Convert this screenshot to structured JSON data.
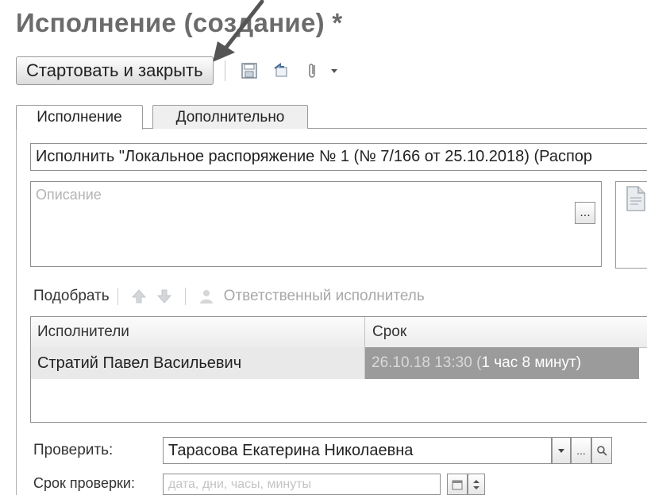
{
  "window": {
    "title": "Исполнение (создание) *"
  },
  "toolbar": {
    "start_close_label": "Стартовать и закрыть"
  },
  "tabs": [
    {
      "label": "Исполнение",
      "active": true
    },
    {
      "label": "Дополнительно",
      "active": false
    }
  ],
  "form": {
    "subject_value": "Исполнить \"Локальное распоряжение № 1 (№ 7/166 от 25.10.2018) (Распор",
    "description_placeholder": "Описание",
    "dots": "..."
  },
  "executors_toolbar": {
    "pick_label": "Подобрать",
    "responsible_label": "Ответственный исполнитель"
  },
  "table": {
    "columns": [
      "Исполнители",
      "Срок"
    ],
    "rows": [
      {
        "executor": "Стратий Павел Васильевич",
        "deadline_date": "26.10.18 13:30 (",
        "deadline_rest": "1 час 8 минут)"
      }
    ]
  },
  "check": {
    "label": "Проверить:",
    "value": "Тарасова Екатерина Николаевна",
    "dots": "..."
  },
  "check_deadline": {
    "label": "Срок проверки:",
    "placeholder": "дата, дни, часы, минуты"
  },
  "colors": {
    "title": "#6b6b6b",
    "selected_cell": "#9b9b9b",
    "row_highlight": "#e9e9e9"
  }
}
